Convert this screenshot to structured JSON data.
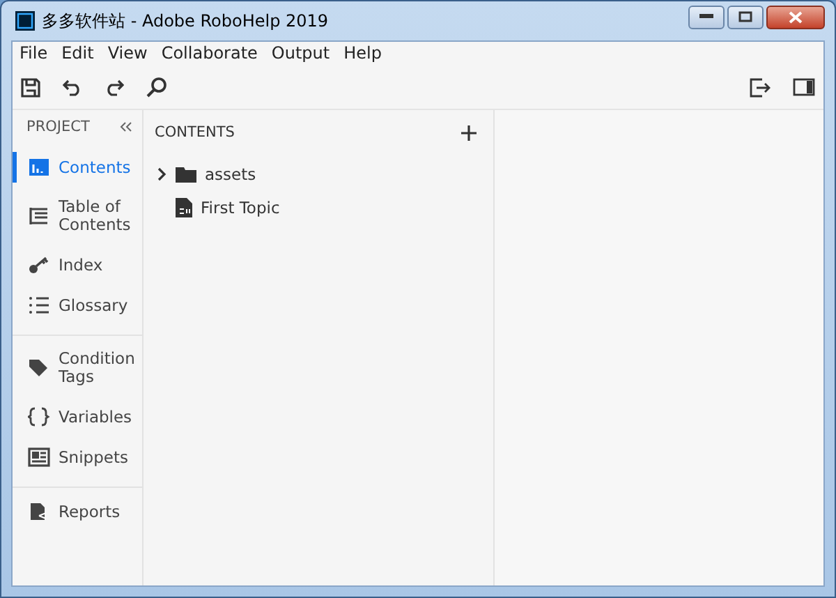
{
  "window": {
    "title": "多多软件站 - Adobe RoboHelp 2019"
  },
  "menu": [
    "File",
    "Edit",
    "View",
    "Collaborate",
    "Output",
    "Help"
  ],
  "sidebar": {
    "header": "PROJECT",
    "groups": [
      [
        {
          "label": "Contents",
          "selected": true
        },
        {
          "label": "Table of Contents",
          "selected": false
        },
        {
          "label": "Index",
          "selected": false
        },
        {
          "label": "Glossary",
          "selected": false
        }
      ],
      [
        {
          "label": "Condition Tags",
          "selected": false
        },
        {
          "label": "Variables",
          "selected": false
        },
        {
          "label": "Snippets",
          "selected": false
        }
      ],
      [
        {
          "label": "Reports",
          "selected": false
        }
      ]
    ]
  },
  "contents": {
    "title": "CONTENTS",
    "tree": [
      {
        "kind": "folder",
        "label": "assets",
        "expanded": false
      },
      {
        "kind": "topic",
        "label": "First Topic"
      }
    ]
  }
}
